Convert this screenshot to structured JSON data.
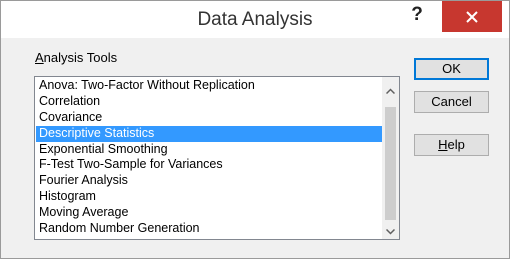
{
  "window": {
    "title": "Data Analysis",
    "help_glyph": "?",
    "close_icon": "close-icon"
  },
  "analysis_tools": {
    "label_accel": "A",
    "label_rest": "nalysis Tools",
    "items": [
      "Anova: Two-Factor Without Replication",
      "Correlation",
      "Covariance",
      "Descriptive Statistics",
      "Exponential Smoothing",
      "F-Test Two-Sample for Variances",
      "Fourier Analysis",
      "Histogram",
      "Moving Average",
      "Random Number Generation"
    ],
    "selected": "Descriptive Statistics"
  },
  "buttons": {
    "ok": "OK",
    "cancel": "Cancel",
    "help_accel": "H",
    "help_rest": "elp"
  },
  "colors": {
    "selection": "#3399ff",
    "close_button": "#c7372f",
    "dialog_background": "#f0f0f0"
  }
}
